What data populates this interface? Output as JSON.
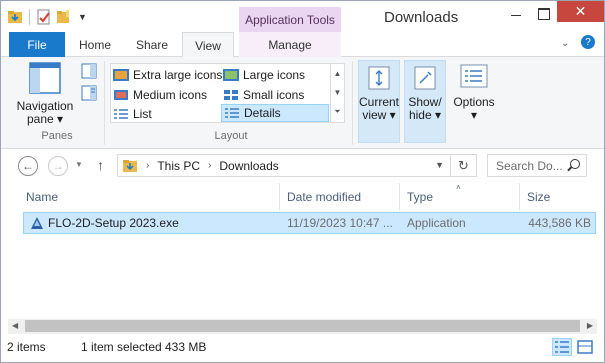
{
  "window": {
    "title": "Downloads",
    "context_tab_header": "Application Tools",
    "close_glyph": "✕"
  },
  "ribbon_tabs": {
    "file": "File",
    "home": "Home",
    "share": "Share",
    "view": "View",
    "manage": "Manage"
  },
  "ribbon": {
    "panes": {
      "navigation_pane": "Navigation",
      "navigation_pane_line2": "pane",
      "group_label": "Panes"
    },
    "layout": {
      "items": [
        "Extra large icons",
        "Large icons",
        "Medium icons",
        "Small icons",
        "List",
        "Details"
      ],
      "selected": "Details",
      "group_label": "Layout"
    },
    "current_view": {
      "line1": "Current",
      "line2": "view"
    },
    "show_hide": {
      "line1": "Show/",
      "line2": "hide"
    },
    "options": {
      "label": "Options"
    }
  },
  "address": {
    "segments": [
      "This PC",
      "Downloads"
    ],
    "search_placeholder": "Search Do..."
  },
  "file_list": {
    "columns": [
      "Name",
      "Date modified",
      "Type",
      "Size"
    ],
    "sorted_column": "Type",
    "rows": [
      {
        "name": "FLO-2D-Setup 2023.exe",
        "date_modified": "11/19/2023 10:47 ...",
        "type": "Application",
        "size": "443,586 KB",
        "selected": true
      }
    ]
  },
  "status": {
    "items_count": "2 items",
    "selection": "1 item selected",
    "selection_size": "433 MB",
    "view_mode": "Details"
  },
  "colors": {
    "accent": "#1979ca",
    "selection": "#cce8ff",
    "selection_border": "#99d1ff",
    "context_tab": "#ead6f0",
    "close": "#c7473e"
  }
}
